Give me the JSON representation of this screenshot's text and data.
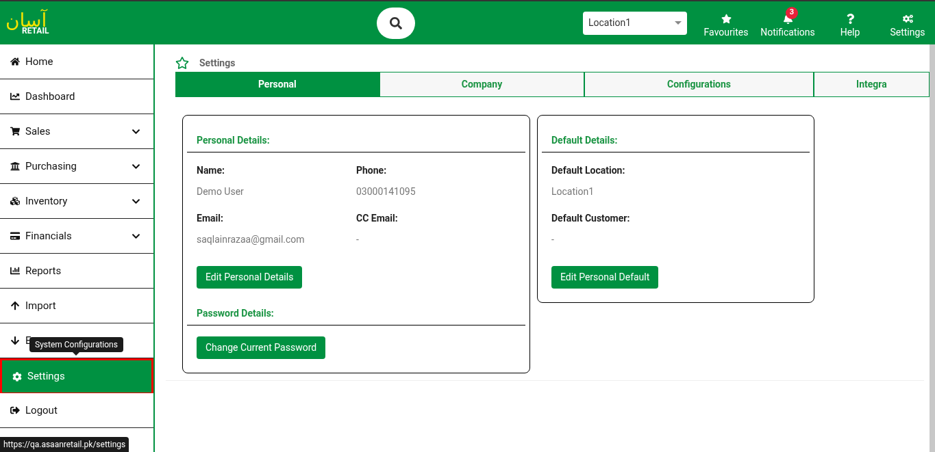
{
  "header": {
    "logo": {
      "script": "آسان",
      "word": "RETAIL"
    },
    "location": {
      "value": "Location1"
    },
    "actions": [
      {
        "kind": "star",
        "label": "Favourites"
      },
      {
        "kind": "bell",
        "label": "Notifications",
        "badge": "3"
      },
      {
        "kind": "help",
        "label": "Help"
      },
      {
        "kind": "gears",
        "label": "Settings"
      }
    ]
  },
  "sidebar": {
    "items": [
      {
        "kind": "home",
        "label": "Home",
        "selected": false,
        "expandable": false
      },
      {
        "kind": "chart",
        "label": "Dashboard",
        "selected": false,
        "expandable": false
      },
      {
        "kind": "cart",
        "label": "Sales",
        "selected": false,
        "expandable": true
      },
      {
        "kind": "bank",
        "label": "Purchasing",
        "selected": false,
        "expandable": true
      },
      {
        "kind": "cubes",
        "label": "Inventory",
        "selected": false,
        "expandable": true
      },
      {
        "kind": "card",
        "label": "Financials",
        "selected": false,
        "expandable": true
      },
      {
        "kind": "bars",
        "label": "Reports",
        "selected": false,
        "expandable": false
      },
      {
        "kind": "up",
        "label": "Import",
        "selected": false,
        "expandable": false
      },
      {
        "kind": "down",
        "label": "E",
        "selected": false,
        "expandable": false,
        "tooltip": "System Configurations"
      },
      {
        "kind": "gear",
        "label": "Settings",
        "selected": true,
        "expandable": false
      },
      {
        "kind": "logout",
        "label": "Logout",
        "selected": false,
        "expandable": false
      }
    ]
  },
  "page": {
    "title": "Settings",
    "tabs": [
      {
        "label": "Personal",
        "selected": true
      },
      {
        "label": "Company",
        "selected": false
      },
      {
        "label": "Configurations",
        "selected": false
      },
      {
        "label": "Integra",
        "selected": false
      }
    ],
    "personal_card": {
      "sections": [
        {
          "heading": "Personal Details:",
          "fields": [
            {
              "label": "Name:",
              "value": "Demo User"
            },
            {
              "label": "Phone:",
              "value": "03000141095"
            },
            {
              "label": "Email:",
              "value": "saqlainrazaa@gmail.com"
            },
            {
              "label": "CC Email:",
              "value": "-"
            }
          ],
          "button": "Edit Personal Details"
        },
        {
          "heading": "Password Details:",
          "button": "Change Current Password"
        }
      ]
    },
    "default_card": {
      "sections": [
        {
          "heading": "Default Details:",
          "fields": [
            {
              "label": "Default Location:",
              "value": "Location1"
            },
            {
              "label": "Default Customer:",
              "value": "-"
            }
          ],
          "button": "Edit Personal Default"
        }
      ]
    }
  },
  "status_url": "https://qa.asaanretail.pk/settings"
}
